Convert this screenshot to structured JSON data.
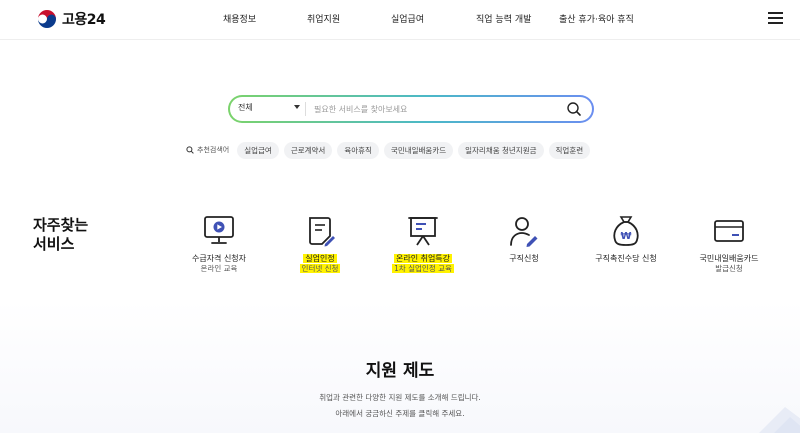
{
  "header": {
    "logo_text": "고용24",
    "nav": [
      "채용정보",
      "취업지원",
      "실업급여",
      "직업 능력 개발",
      "출산 휴가·육아 휴직"
    ]
  },
  "search": {
    "category": "전체",
    "placeholder": "필요한 서비스를 찾아보세요"
  },
  "keywords": {
    "label": "추천검색어",
    "items": [
      "실업급여",
      "근로계약서",
      "육아휴직",
      "국민내일배움카드",
      "일자리채움 청년지원금",
      "직업훈련"
    ]
  },
  "favorites": {
    "title": "자주찾는\n서비스",
    "services": [
      {
        "label": "수급자격 신청자",
        "sub": "온라인 교육",
        "icon": "monitor-play-icon"
      },
      {
        "label": "실업인정",
        "sub": "인터넷 신청",
        "icon": "document-pen-icon"
      },
      {
        "label": "온라인 취업특강",
        "sub": "1차 실업인정 교육",
        "icon": "presentation-board-icon"
      },
      {
        "label": "구직신청",
        "sub": "",
        "icon": "person-pen-icon"
      },
      {
        "label": "구직촉진수당 신청",
        "sub": "",
        "icon": "money-bag-icon"
      },
      {
        "label": "국민내일배움카드",
        "sub": "발급신청",
        "icon": "card-icon"
      }
    ]
  },
  "support": {
    "title": "지원 제도",
    "desc1": "취업과 관련한 다양한 지원 제도를 소개해 드립니다.",
    "desc2": "아래에서 궁금하신 주제를 클릭해 주세요."
  },
  "colors": {
    "accent": "#3f51b5",
    "highlight": "#fff200"
  }
}
